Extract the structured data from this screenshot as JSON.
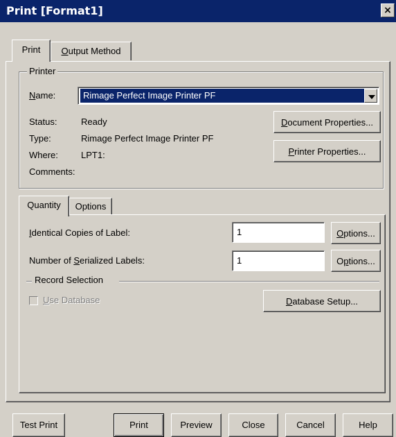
{
  "window": {
    "title": "Print [Format1]",
    "close_glyph": "×"
  },
  "tabs_main": [
    {
      "label": "Print",
      "active": true
    },
    {
      "label": "Output Method",
      "ul": "O",
      "rest": "utput Method",
      "active": false
    }
  ],
  "printer": {
    "group_label": "Printer",
    "name_label_ul": "N",
    "name_label_rest": "ame:",
    "name_value": "Rimage Perfect Image Printer PF",
    "status_label": "Status:",
    "status_value": "Ready",
    "type_label": "Type:",
    "type_value": "Rimage Perfect Image Printer PF",
    "where_label": "Where:",
    "where_value": "LPT1:",
    "comments_label": "Comments:",
    "doc_props_ul": "D",
    "doc_props_rest": "ocument Properties...",
    "printer_props_ul": "P",
    "printer_props_rest": "rinter Properties..."
  },
  "tabs_sub": [
    {
      "label": "Quantity",
      "active": true
    },
    {
      "label": "Options",
      "active": false
    }
  ],
  "quantity": {
    "identical_ul": "I",
    "identical_rest": "dentical Copies of Label:",
    "identical_value": "1",
    "serial_pre": "Number of ",
    "serial_ul": "S",
    "serial_rest": "erialized Labels:",
    "serial_value": "1",
    "options_ul": "O",
    "options_rest": "ptions...",
    "options2_pre": "O",
    "options2_ul": "p",
    "options2_rest": "tions...",
    "record_selection": "Record Selection",
    "use_db_ul": "U",
    "use_db_rest": "se Database",
    "db_setup_ul": "D",
    "db_setup_rest": "atabase Setup..."
  },
  "footer": {
    "test_print": "Test Print",
    "print": "Print",
    "preview": "Preview",
    "close": "Close",
    "cancel": "Cancel",
    "help": "Help"
  }
}
